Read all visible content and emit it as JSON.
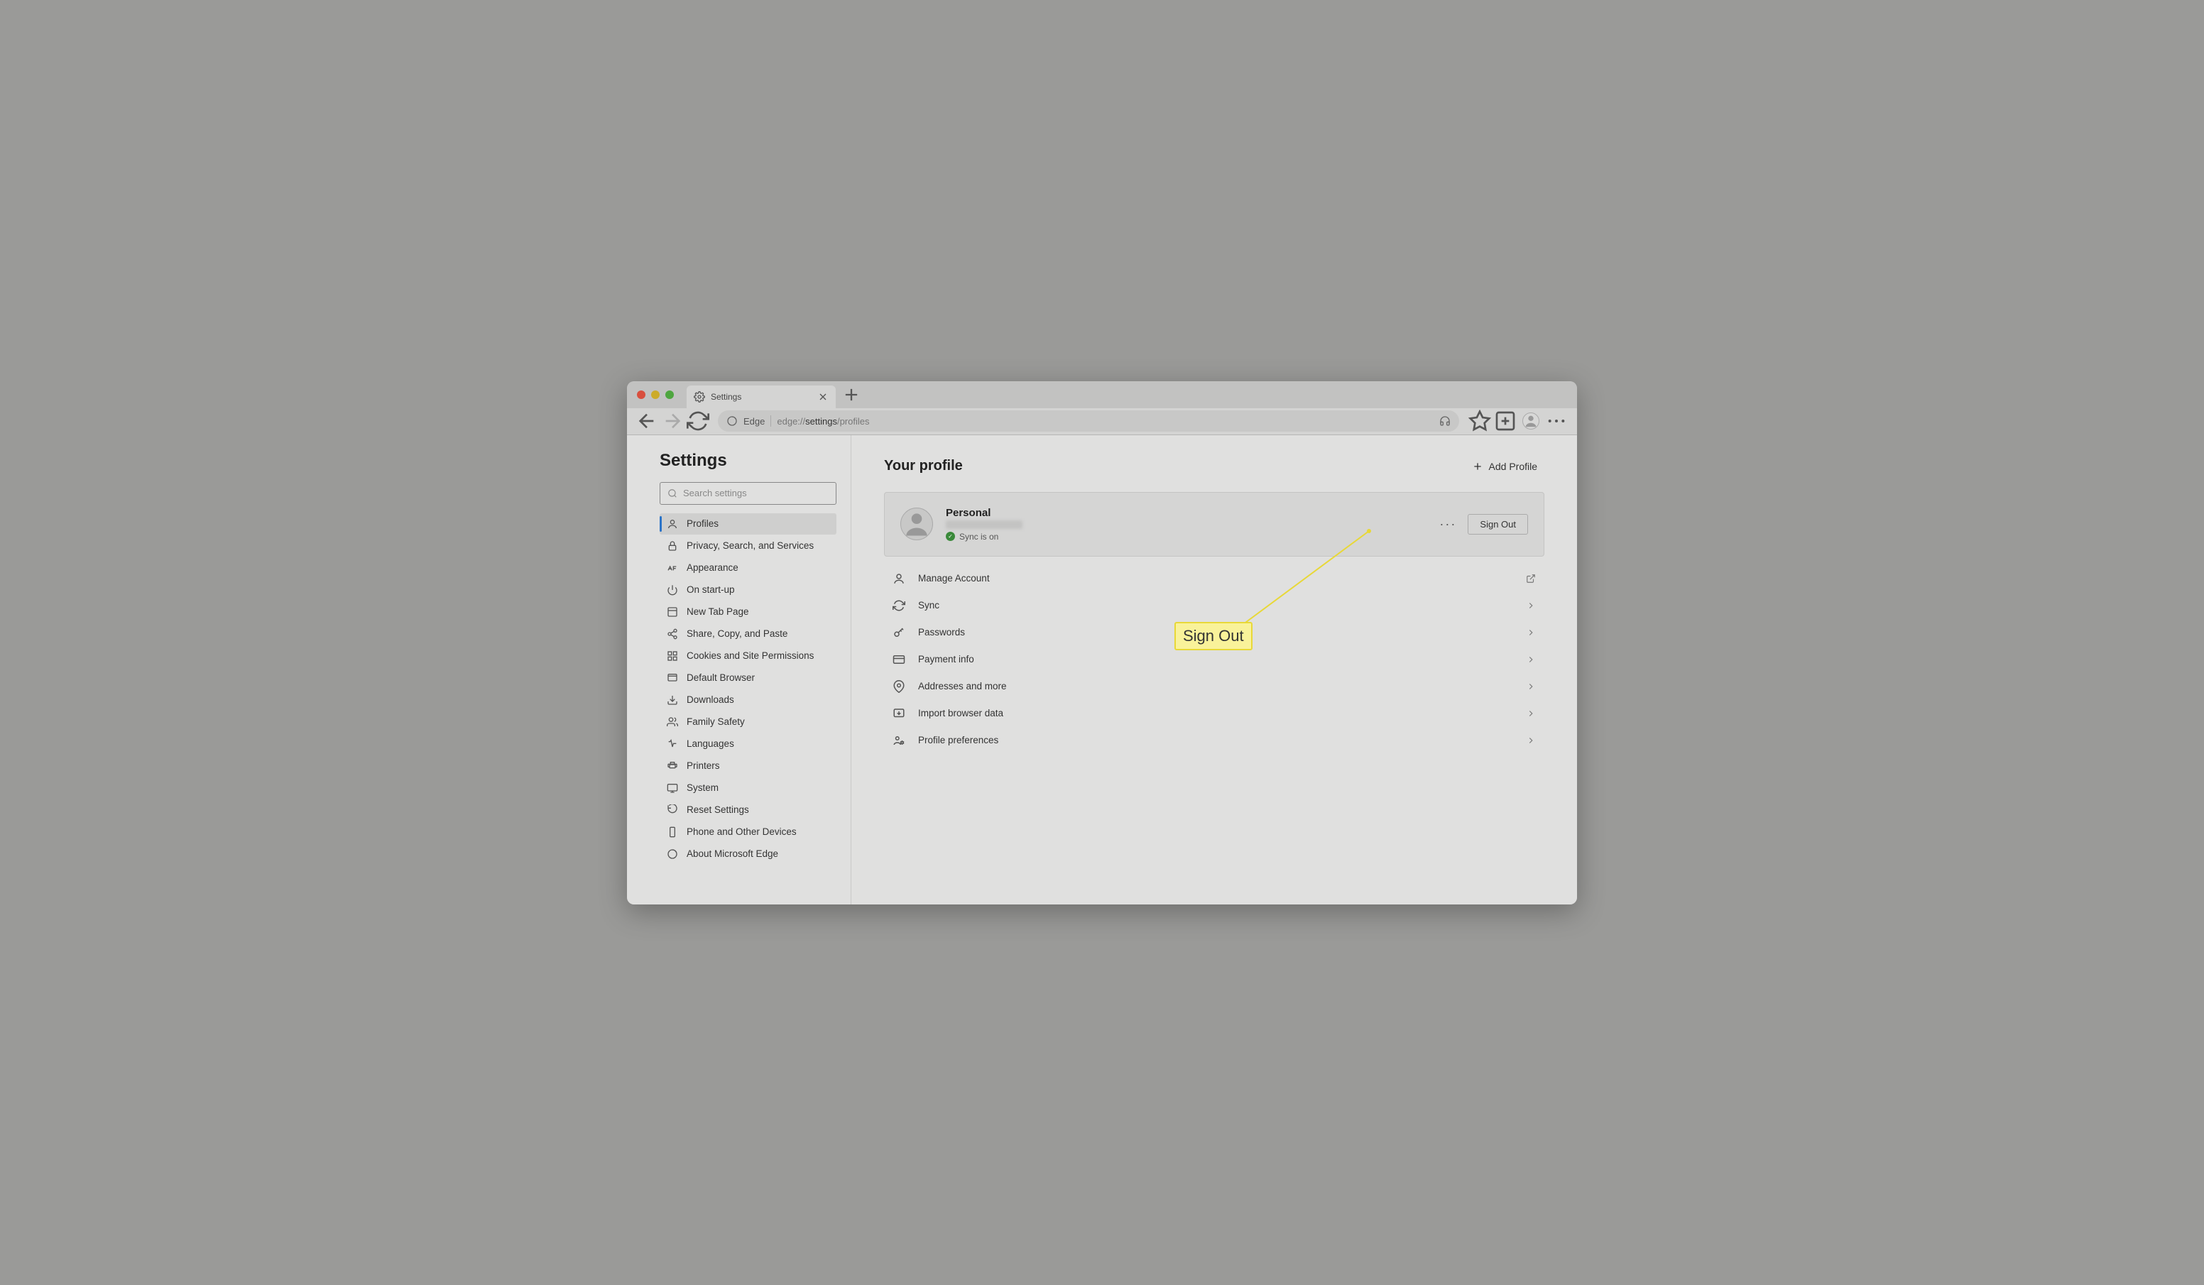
{
  "window": {
    "tab_title": "Settings",
    "address_label": "Edge",
    "address_prefix": "edge://",
    "address_bold": "settings",
    "address_suffix": "/profiles"
  },
  "sidebar": {
    "title": "Settings",
    "search_placeholder": "Search settings",
    "items": [
      {
        "label": "Profiles",
        "active": true
      },
      {
        "label": "Privacy, Search, and Services",
        "active": false
      },
      {
        "label": "Appearance",
        "active": false
      },
      {
        "label": "On start-up",
        "active": false
      },
      {
        "label": "New Tab Page",
        "active": false
      },
      {
        "label": "Share, Copy, and Paste",
        "active": false
      },
      {
        "label": "Cookies and Site Permissions",
        "active": false
      },
      {
        "label": "Default Browser",
        "active": false
      },
      {
        "label": "Downloads",
        "active": false
      },
      {
        "label": "Family Safety",
        "active": false
      },
      {
        "label": "Languages",
        "active": false
      },
      {
        "label": "Printers",
        "active": false
      },
      {
        "label": "System",
        "active": false
      },
      {
        "label": "Reset Settings",
        "active": false
      },
      {
        "label": "Phone and Other Devices",
        "active": false
      },
      {
        "label": "About Microsoft Edge",
        "active": false
      }
    ]
  },
  "main": {
    "title": "Your profile",
    "add_profile": "Add Profile",
    "profile": {
      "name": "Personal",
      "sync_status": "Sync is on",
      "more_label": "···",
      "signout": "Sign Out"
    },
    "options": [
      {
        "label": "Manage Account",
        "trail": "external"
      },
      {
        "label": "Sync",
        "trail": "chevron"
      },
      {
        "label": "Passwords",
        "trail": "chevron"
      },
      {
        "label": "Payment info",
        "trail": "chevron"
      },
      {
        "label": "Addresses and more",
        "trail": "chevron"
      },
      {
        "label": "Import browser data",
        "trail": "chevron"
      },
      {
        "label": "Profile preferences",
        "trail": "chevron"
      }
    ]
  },
  "callout": {
    "label": "Sign Out"
  }
}
